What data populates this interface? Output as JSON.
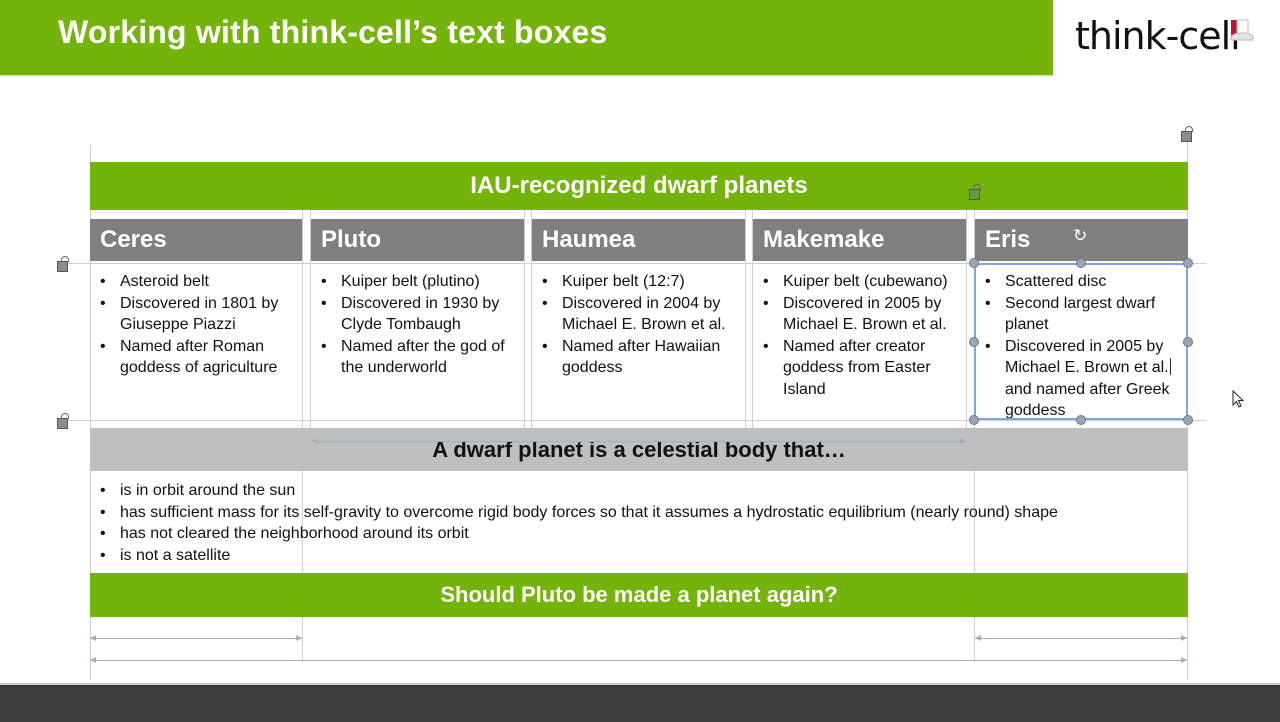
{
  "slide": {
    "title": "Working with think-cell’s text boxes",
    "logo_text": "think-cell",
    "logo_icon": "think-cell-logo-mark"
  },
  "table": {
    "header": "IAU-recognized dwarf planets",
    "planets": [
      {
        "name": "Ceres",
        "facts": [
          "Asteroid belt",
          "Discovered in 1801 by Giuseppe Piazzi",
          "Named after Roman goddess of agriculture"
        ]
      },
      {
        "name": "Pluto",
        "facts": [
          "Kuiper belt (plutino)",
          "Discovered in 1930 by Clyde Tombaugh",
          "Named after the god of the underworld"
        ]
      },
      {
        "name": "Haumea",
        "facts": [
          "Kuiper belt (12:7)",
          "Discovered in 2004 by Michael E. Brown et al.",
          "Named after Hawaiian goddess"
        ]
      },
      {
        "name": "Makemake",
        "facts": [
          "Kuiper belt (cubewano)",
          "Discovered in 2005 by Michael E. Brown et al.",
          "Named after creator goddess from Easter Island"
        ]
      },
      {
        "name": "Eris",
        "facts": [
          "Scattered disc",
          "Second largest dwarf planet",
          "Discovered in 2005 by Michael E. Brown et al.",
          "and named after Greek goddess"
        ]
      }
    ],
    "definition_header": "A dwarf planet is a celestial body that…",
    "criteria": [
      "is in orbit around the sun",
      "has sufficient mass for its self-gravity to overcome rigid body forces so that it assumes a hydrostatic equilibrium (nearly round) shape",
      "has not cleared the neighborhood around its orbit",
      "is not a satellite"
    ],
    "question": "Should Pluto be made a planet again?"
  },
  "colors": {
    "brand_green": "#74b30a",
    "header_gray": "#7f7f7f",
    "band_gray": "#bfbfbf",
    "selection_blue": "#7aa7e6",
    "footer_dark": "#3c3c3c"
  }
}
